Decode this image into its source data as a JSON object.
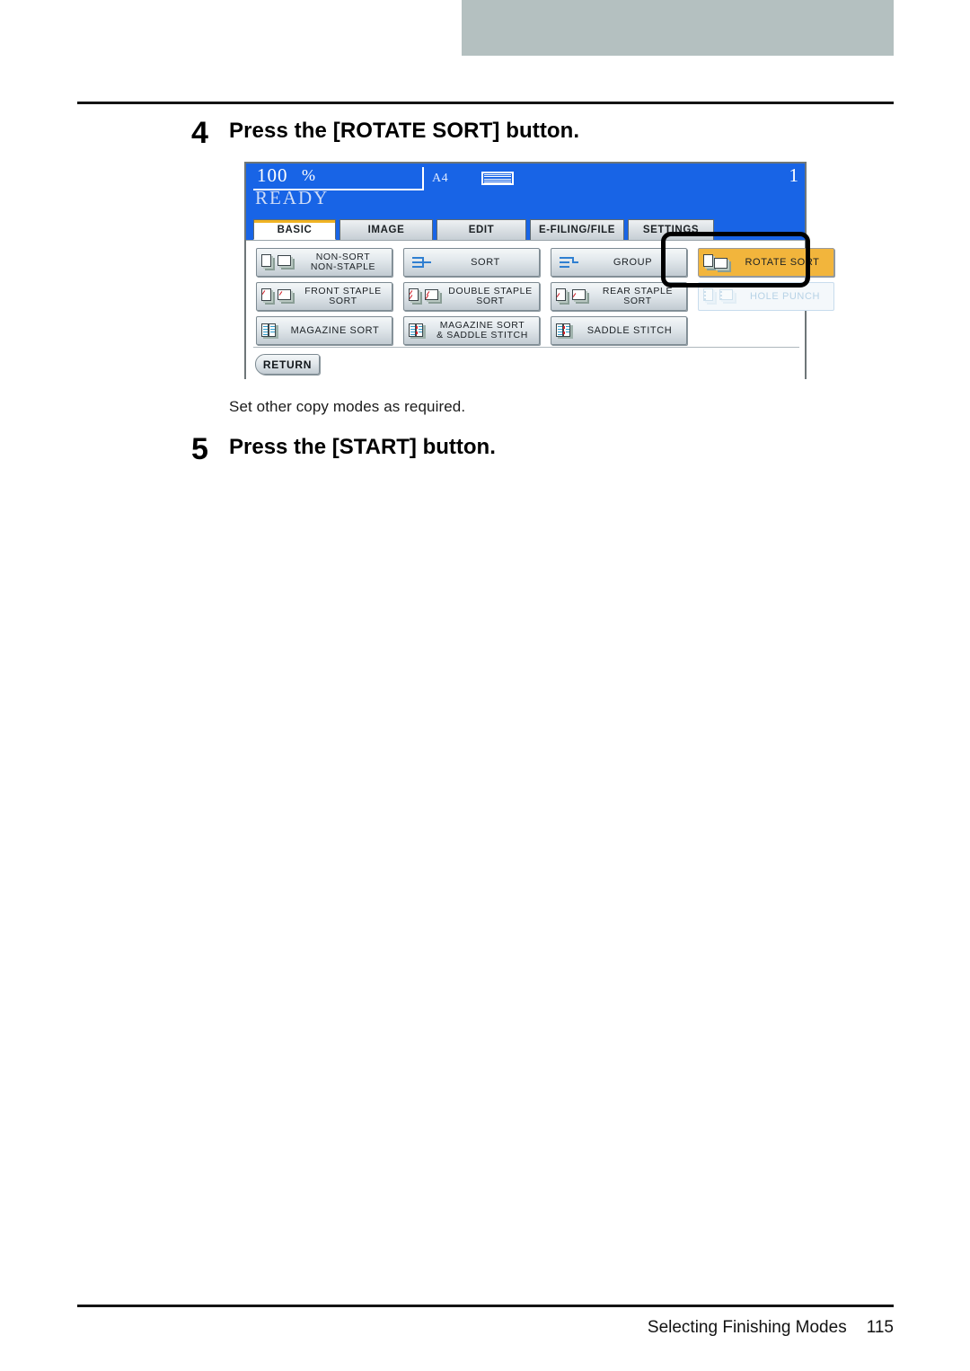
{
  "page": {
    "footer_section": "Selecting Finishing Modes",
    "footer_page_number": "115"
  },
  "steps": [
    {
      "number": "4",
      "text": "Press the [ROTATE SORT] button."
    },
    {
      "number": "5",
      "text": "Press the [START] button."
    }
  ],
  "caption": "Set other copy modes as required.",
  "lcd": {
    "zoom_value": "100",
    "zoom_unit": "%",
    "copy_count": "1",
    "paper_size": "A4",
    "tray_icon": "paper-tray-icon",
    "status": "READY",
    "tabs": [
      {
        "label": "BASIC",
        "active": true
      },
      {
        "label": "IMAGE",
        "active": false
      },
      {
        "label": "EDIT",
        "active": false
      },
      {
        "label": "E-FILING/FILE",
        "active": false
      },
      {
        "label": "SETTINGS",
        "active": false
      }
    ],
    "buttons": [
      {
        "id": "non-sort-non-staple",
        "line1": "NON-SORT",
        "line2": "NON-STAPLE",
        "state": "normal",
        "icon": "paper-stack-icon"
      },
      {
        "id": "sort",
        "line1": "SORT",
        "line2": "",
        "state": "normal",
        "icon": "sort-lines-icon"
      },
      {
        "id": "group",
        "line1": "GROUP",
        "line2": "",
        "state": "normal",
        "icon": "group-lines-icon"
      },
      {
        "id": "rotate-sort",
        "line1": "ROTATE SORT",
        "line2": "",
        "state": "selected",
        "icon": "rotate-paper-icon"
      },
      {
        "id": "front-staple-sort",
        "line1": "FRONT STAPLE",
        "line2": "SORT",
        "state": "normal",
        "icon": "front-staple-icon"
      },
      {
        "id": "double-staple-sort",
        "line1": "DOUBLE STAPLE",
        "line2": "SORT",
        "state": "normal",
        "icon": "double-staple-icon"
      },
      {
        "id": "rear-staple-sort",
        "line1": "REAR  STAPLE",
        "line2": "SORT",
        "state": "normal",
        "icon": "rear-staple-icon"
      },
      {
        "id": "hole-punch",
        "line1": "HOLE PUNCH",
        "line2": "",
        "state": "disabled",
        "icon": "hole-punch-icon"
      },
      {
        "id": "magazine-sort",
        "line1": "MAGAZINE SORT",
        "line2": "",
        "state": "normal",
        "icon": "magazine-book-icon"
      },
      {
        "id": "magazine-sort-saddle-stitch",
        "line1": "MAGAZINE SORT",
        "line2": "& SADDLE STITCH",
        "state": "normal",
        "icon": "magazine-saddle-icon"
      },
      {
        "id": "saddle-stitch",
        "line1": "SADDLE STITCH",
        "line2": "",
        "state": "normal",
        "icon": "saddle-stitch-icon"
      }
    ],
    "return_label": "RETURN",
    "highlight_target": "rotate-sort",
    "colors": {
      "status_bar": "#1864e6",
      "selected_button": "#f2b53c",
      "active_tab_accent": "#f0b323",
      "disabled_text": "#b7d2e6",
      "top_band": "#b4c0c0"
    }
  }
}
